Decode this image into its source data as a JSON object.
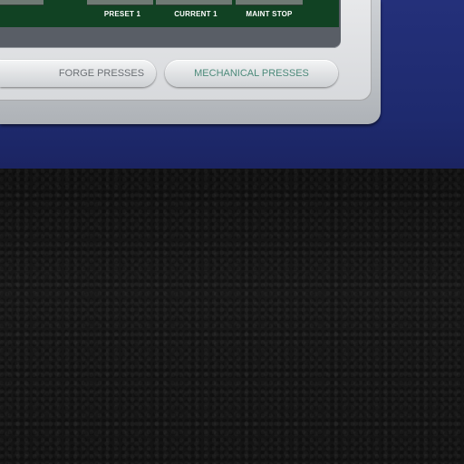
{
  "screen": {
    "labels": {
      "preset": "PRESET 1",
      "current": "CURRENT 1",
      "maint_stop": "MAINT STOP"
    }
  },
  "nav": {
    "forge": "FORGE PRESSES",
    "mechanical": "MECHANICAL PRESSES"
  },
  "colors": {
    "screen_green": "#114223",
    "panel_blue": "#1e2a6e",
    "bezel_silver": "#c8cbcf",
    "active_text": "#4c8a7a",
    "inactive_text": "#6b6f74"
  }
}
